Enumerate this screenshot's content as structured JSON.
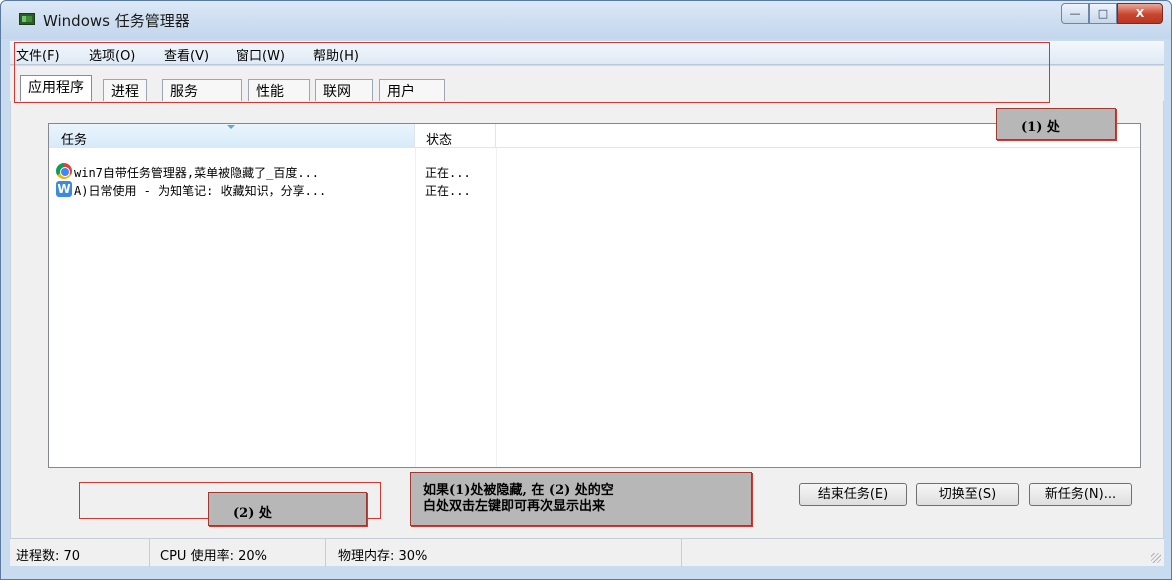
{
  "window": {
    "title": "Windows 任务管理器",
    "controls": {
      "minimize": "—",
      "maximize": "□",
      "close": "X"
    }
  },
  "menu": [
    {
      "label": "文件(F)"
    },
    {
      "label": "选项(O)"
    },
    {
      "label": "查看(V)"
    },
    {
      "label": "窗口(W)"
    },
    {
      "label": "帮助(H)"
    }
  ],
  "tabs": [
    {
      "label": "应用程序",
      "active": true
    },
    {
      "label": "进程"
    },
    {
      "label": "服务"
    },
    {
      "label": "性能"
    },
    {
      "label": "联网"
    },
    {
      "label": "用户"
    }
  ],
  "table": {
    "columns": [
      "任务",
      "状态"
    ],
    "rows": [
      {
        "icon": "chrome-icon",
        "task": "win7自带任务管理器,菜单被隐藏了_百度...",
        "status": "正在..."
      },
      {
        "icon": "wiz-note-icon",
        "icon_letter": "W",
        "task": "A)日常使用 - 为知笔记: 收藏知识，分享...",
        "status": "正在..."
      }
    ]
  },
  "buttons": {
    "end_task": "结束任务(E)",
    "switch_to": "切换至(S)",
    "new_task": "新任务(N)..."
  },
  "status_bar": {
    "processes": "进程数: 70",
    "cpu": "CPU 使用率: 20%",
    "memory": "物理内存: 30%"
  },
  "annotations": {
    "label_1": "(1) 处",
    "label_2": "(2) 处",
    "note_line1": "如果(1)处被隐藏, 在 (2) 处的空",
    "note_line2": "白处双击左键即可再次显示出来"
  },
  "colors": {
    "annotation_border": "#e0322b",
    "annotation_fill": "#b7b7b7",
    "header_highlight": "#d7eaf9"
  }
}
